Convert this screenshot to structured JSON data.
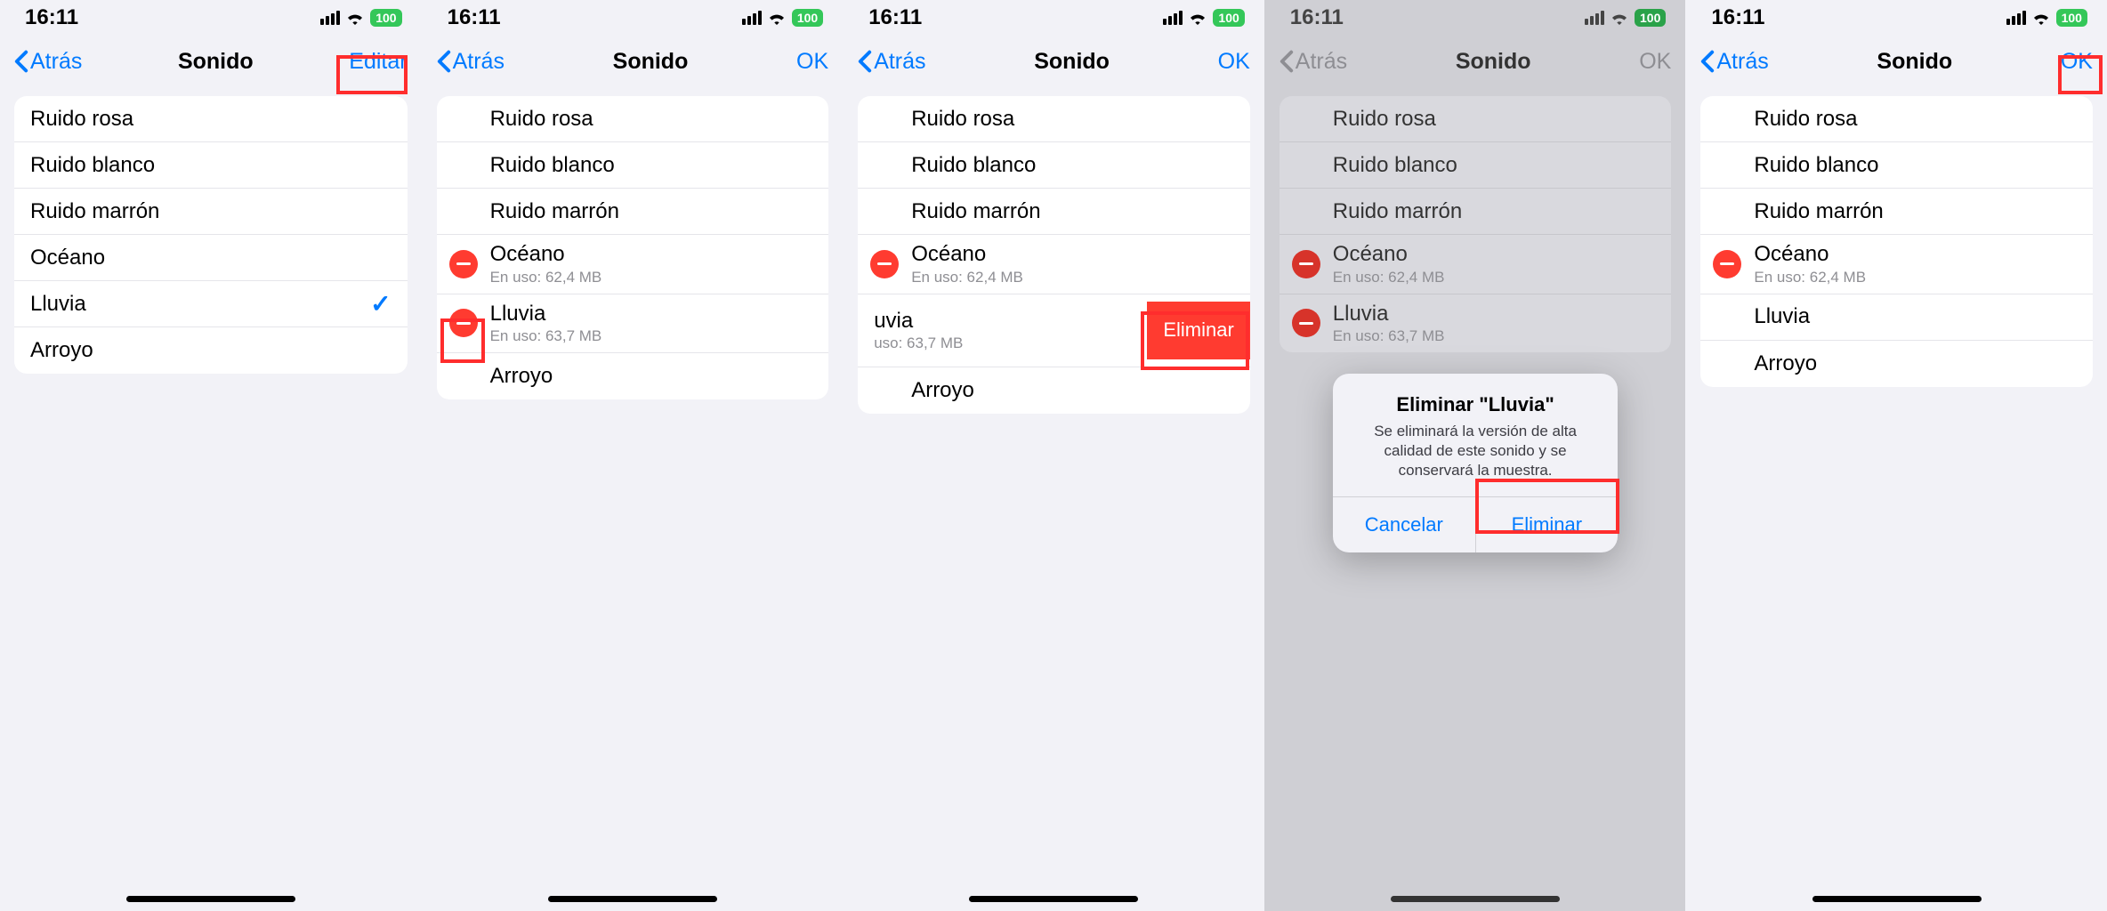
{
  "status": {
    "time": "16:11",
    "battery": "100"
  },
  "back": "Atrás",
  "title": "Sonido",
  "actions": {
    "edit": "Editar",
    "ok": "OK"
  },
  "sounds": {
    "rosa": "Ruido rosa",
    "blanco": "Ruido blanco",
    "marron": "Ruido marrón",
    "oceano": "Océano",
    "oceano_sub": "En uso: 62,4 MB",
    "lluvia": "Lluvia",
    "lluvia_sub": "En uso: 63,7 MB",
    "lluvia_swiped_label": "uvia",
    "lluvia_swiped_sub": "uso: 63,7 MB",
    "arroyo": "Arroyo"
  },
  "swipe_delete": "Eliminar",
  "alert": {
    "title": "Eliminar \"Lluvia\"",
    "msg": "Se eliminará la versión de alta calidad de este sonido y se conservará la muestra.",
    "cancel": "Cancelar",
    "confirm": "Eliminar"
  }
}
